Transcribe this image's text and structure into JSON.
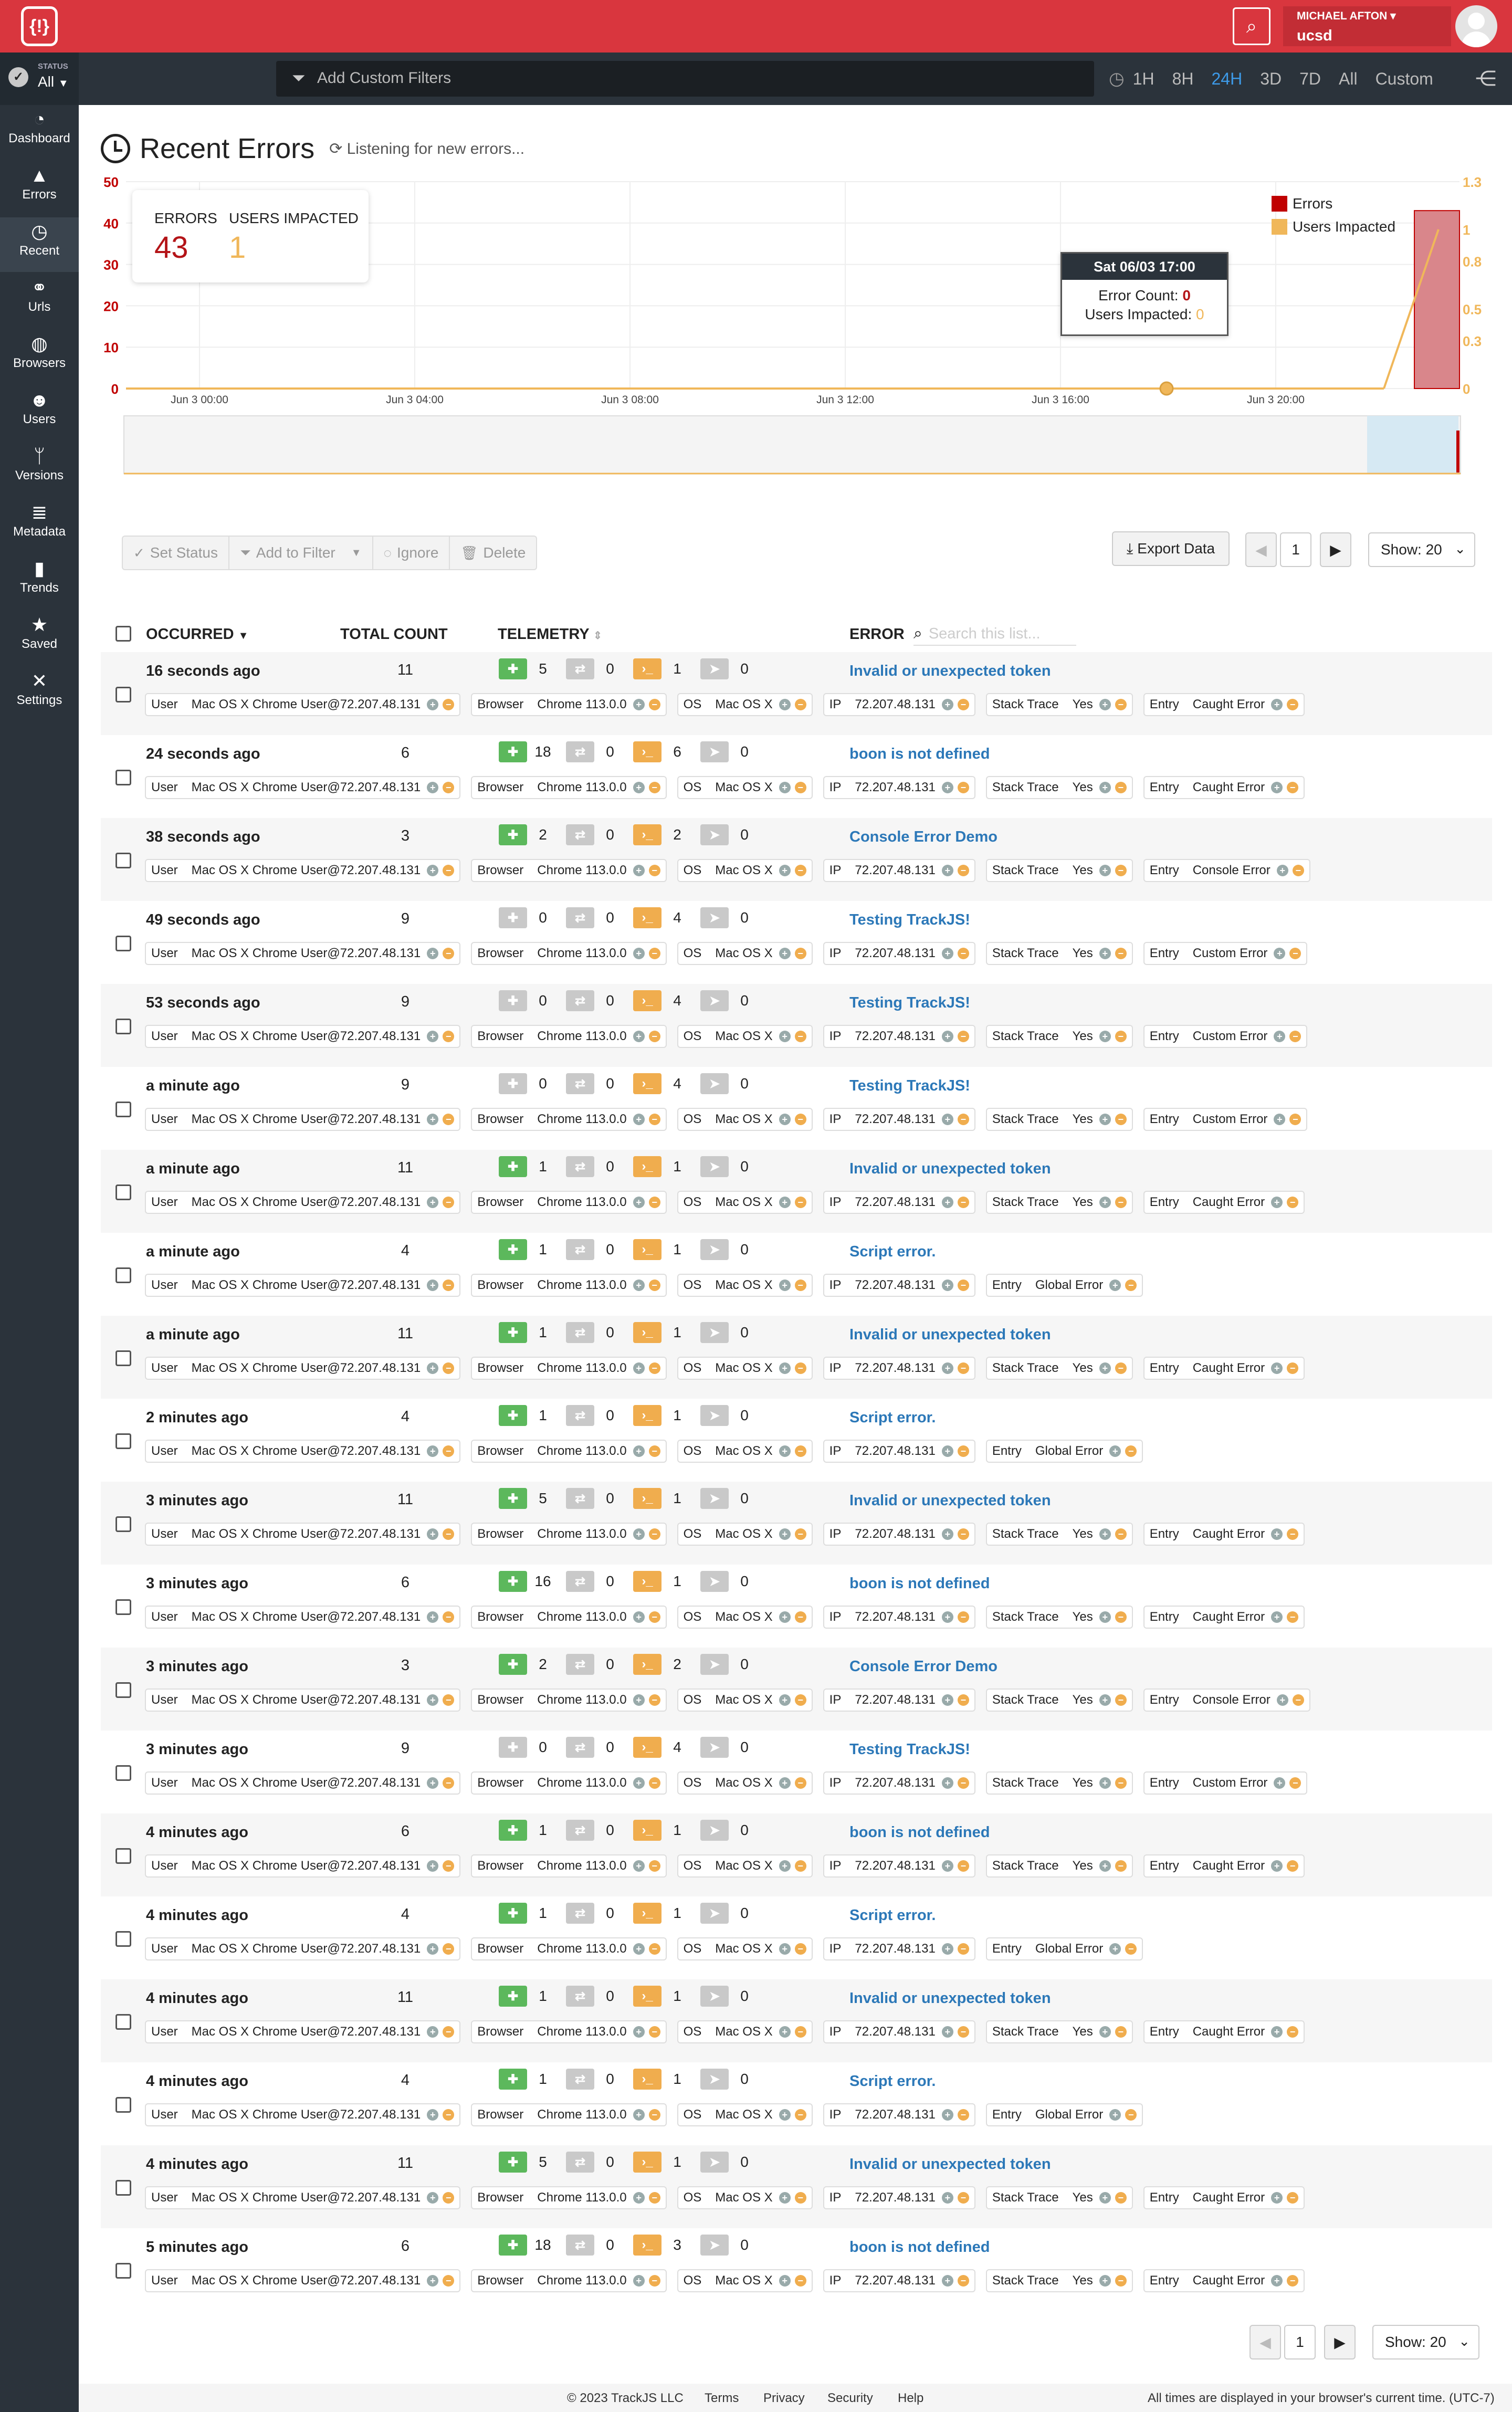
{
  "topbar": {
    "user_name": "MICHAEL AFTON",
    "user_org": "ucsd",
    "logo_text": "{!}",
    "accent": "#d9363e"
  },
  "status": {
    "label": "STATUS",
    "value": "All"
  },
  "filter": {
    "placeholder": "Add Custom Filters"
  },
  "time_ranges": [
    {
      "label": "1H",
      "active": false
    },
    {
      "label": "8H",
      "active": false
    },
    {
      "label": "24H",
      "active": true
    },
    {
      "label": "3D",
      "active": false
    },
    {
      "label": "7D",
      "active": false
    },
    {
      "label": "All",
      "active": false
    },
    {
      "label": "Custom",
      "active": false
    }
  ],
  "sidebar": {
    "items": [
      {
        "label": "Dashboard",
        "icon": "dashboard-icon",
        "active": false
      },
      {
        "label": "Errors",
        "icon": "warning-icon",
        "active": false
      },
      {
        "label": "Recent",
        "icon": "clock-icon",
        "active": true
      },
      {
        "label": "Urls",
        "icon": "link-icon",
        "active": false
      },
      {
        "label": "Browsers",
        "icon": "globe-icon",
        "active": false
      },
      {
        "label": "Users",
        "icon": "users-icon",
        "active": false
      },
      {
        "label": "Versions",
        "icon": "branch-icon",
        "active": false
      },
      {
        "label": "Metadata",
        "icon": "database-icon",
        "active": false
      },
      {
        "label": "Trends",
        "icon": "bar-chart-icon",
        "active": false
      },
      {
        "label": "Saved",
        "icon": "star-icon",
        "active": false
      },
      {
        "label": "Settings",
        "icon": "tools-icon",
        "active": false
      }
    ]
  },
  "page": {
    "title": "Recent Errors",
    "subtitle": "Listening for new errors..."
  },
  "kpi": {
    "errors_label": "ERRORS",
    "errors_value": "43",
    "users_label": "USERS IMPACTED",
    "users_value": "1"
  },
  "chart_data": {
    "type": "bar",
    "x": [
      "Jun 3 00:00",
      "Jun 3 04:00",
      "Jun 3 08:00",
      "Jun 3 12:00",
      "Jun 3 16:00",
      "Jun 3 20:00"
    ],
    "series": [
      {
        "name": "Errors",
        "color": "#c00000",
        "axis": "left",
        "values": [
          0,
          0,
          0,
          0,
          0,
          43
        ]
      },
      {
        "name": "Users Impacted",
        "color": "#f0b75a",
        "axis": "right",
        "values": [
          0,
          0,
          0,
          0,
          0,
          1
        ]
      }
    ],
    "ylim": [
      0,
      50
    ],
    "y_ticks": [
      0,
      10,
      20,
      30,
      40,
      50
    ],
    "y2lim": [
      0,
      1.3
    ],
    "y2_ticks": [
      "0",
      "0.3",
      "0.5",
      "0.8",
      "1",
      "1.3"
    ],
    "legend": "top-right",
    "grid": true,
    "tooltip": {
      "title": "Sat 06/03 17:00",
      "error_count_label": "Error Count:",
      "error_count": "0",
      "users_label": "Users Impacted:",
      "users": "0"
    }
  },
  "actions": {
    "set_status": "Set Status",
    "add_to_filter": "Add to Filter",
    "ignore": "Ignore",
    "delete": "Delete",
    "export": "Export Data",
    "page": "1",
    "show": "Show: 20"
  },
  "table": {
    "headers": {
      "occurred": "OCCURRED",
      "total": "TOTAL COUNT",
      "telemetry": "TELEMETRY",
      "error": "ERROR",
      "search_placeholder": "Search this list..."
    },
    "rows": [
      {
        "occurred": "16 seconds ago",
        "total": "11",
        "t": [
          "5",
          "0",
          "1",
          "0"
        ],
        "g": true,
        "title": "Invalid or unexpected token",
        "stack": true,
        "entry": "Caught Error"
      },
      {
        "occurred": "24 seconds ago",
        "total": "6",
        "t": [
          "18",
          "0",
          "6",
          "0"
        ],
        "g": true,
        "title": "boon is not defined",
        "stack": true,
        "entry": "Caught Error"
      },
      {
        "occurred": "38 seconds ago",
        "total": "3",
        "t": [
          "2",
          "0",
          "2",
          "0"
        ],
        "g": true,
        "title": "Console Error Demo",
        "stack": true,
        "entry": "Console Error"
      },
      {
        "occurred": "49 seconds ago",
        "total": "9",
        "t": [
          "0",
          "0",
          "4",
          "0"
        ],
        "g": false,
        "title": "Testing TrackJS!",
        "stack": true,
        "entry": "Custom Error"
      },
      {
        "occurred": "53 seconds ago",
        "total": "9",
        "t": [
          "0",
          "0",
          "4",
          "0"
        ],
        "g": false,
        "title": "Testing TrackJS!",
        "stack": true,
        "entry": "Custom Error"
      },
      {
        "occurred": "a minute ago",
        "total": "9",
        "t": [
          "0",
          "0",
          "4",
          "0"
        ],
        "g": false,
        "title": "Testing TrackJS!",
        "stack": true,
        "entry": "Custom Error"
      },
      {
        "occurred": "a minute ago",
        "total": "11",
        "t": [
          "1",
          "0",
          "1",
          "0"
        ],
        "g": true,
        "title": "Invalid or unexpected token",
        "stack": true,
        "entry": "Caught Error"
      },
      {
        "occurred": "a minute ago",
        "total": "4",
        "t": [
          "1",
          "0",
          "1",
          "0"
        ],
        "g": true,
        "title": "Script error.",
        "stack": false,
        "entry": "Global Error"
      },
      {
        "occurred": "a minute ago",
        "total": "11",
        "t": [
          "1",
          "0",
          "1",
          "0"
        ],
        "g": true,
        "title": "Invalid or unexpected token",
        "stack": true,
        "entry": "Caught Error"
      },
      {
        "occurred": "2 minutes ago",
        "total": "4",
        "t": [
          "1",
          "0",
          "1",
          "0"
        ],
        "g": true,
        "title": "Script error.",
        "stack": false,
        "entry": "Global Error"
      },
      {
        "occurred": "3 minutes ago",
        "total": "11",
        "t": [
          "5",
          "0",
          "1",
          "0"
        ],
        "g": true,
        "title": "Invalid or unexpected token",
        "stack": true,
        "entry": "Caught Error"
      },
      {
        "occurred": "3 minutes ago",
        "total": "6",
        "t": [
          "16",
          "0",
          "1",
          "0"
        ],
        "g": true,
        "title": "boon is not defined",
        "stack": true,
        "entry": "Caught Error"
      },
      {
        "occurred": "3 minutes ago",
        "total": "3",
        "t": [
          "2",
          "0",
          "2",
          "0"
        ],
        "g": true,
        "title": "Console Error Demo",
        "stack": true,
        "entry": "Console Error"
      },
      {
        "occurred": "3 minutes ago",
        "total": "9",
        "t": [
          "0",
          "0",
          "4",
          "0"
        ],
        "g": false,
        "title": "Testing TrackJS!",
        "stack": true,
        "entry": "Custom Error"
      },
      {
        "occurred": "4 minutes ago",
        "total": "6",
        "t": [
          "1",
          "0",
          "1",
          "0"
        ],
        "g": true,
        "title": "boon is not defined",
        "stack": true,
        "entry": "Caught Error"
      },
      {
        "occurred": "4 minutes ago",
        "total": "4",
        "t": [
          "1",
          "0",
          "1",
          "0"
        ],
        "g": true,
        "title": "Script error.",
        "stack": false,
        "entry": "Global Error"
      },
      {
        "occurred": "4 minutes ago",
        "total": "11",
        "t": [
          "1",
          "0",
          "1",
          "0"
        ],
        "g": true,
        "title": "Invalid or unexpected token",
        "stack": true,
        "entry": "Caught Error"
      },
      {
        "occurred": "4 minutes ago",
        "total": "4",
        "t": [
          "1",
          "0",
          "1",
          "0"
        ],
        "g": true,
        "title": "Script error.",
        "stack": false,
        "entry": "Global Error"
      },
      {
        "occurred": "4 minutes ago",
        "total": "11",
        "t": [
          "5",
          "0",
          "1",
          "0"
        ],
        "g": true,
        "title": "Invalid or unexpected token",
        "stack": true,
        "entry": "Caught Error"
      },
      {
        "occurred": "5 minutes ago",
        "total": "6",
        "t": [
          "18",
          "0",
          "3",
          "0"
        ],
        "g": true,
        "title": "boon is not defined",
        "stack": true,
        "entry": "Caught Error"
      }
    ],
    "common": {
      "user_k": "User",
      "user_v": "Mac OS X Chrome User@72.207.48.131",
      "browser_k": "Browser",
      "browser_v": "Chrome 113.0.0",
      "os_k": "OS",
      "os_v": "Mac OS X",
      "ip_k": "IP",
      "ip_v": "72.207.48.131",
      "stack_k": "Stack Trace",
      "stack_v": "Yes",
      "entry_k": "Entry"
    }
  },
  "footer": {
    "copyright": "© 2023 TrackJS LLC",
    "links": [
      "Terms",
      "Privacy",
      "Security",
      "Help"
    ],
    "note": "All times are displayed in your browser's current time. (UTC-7)"
  }
}
